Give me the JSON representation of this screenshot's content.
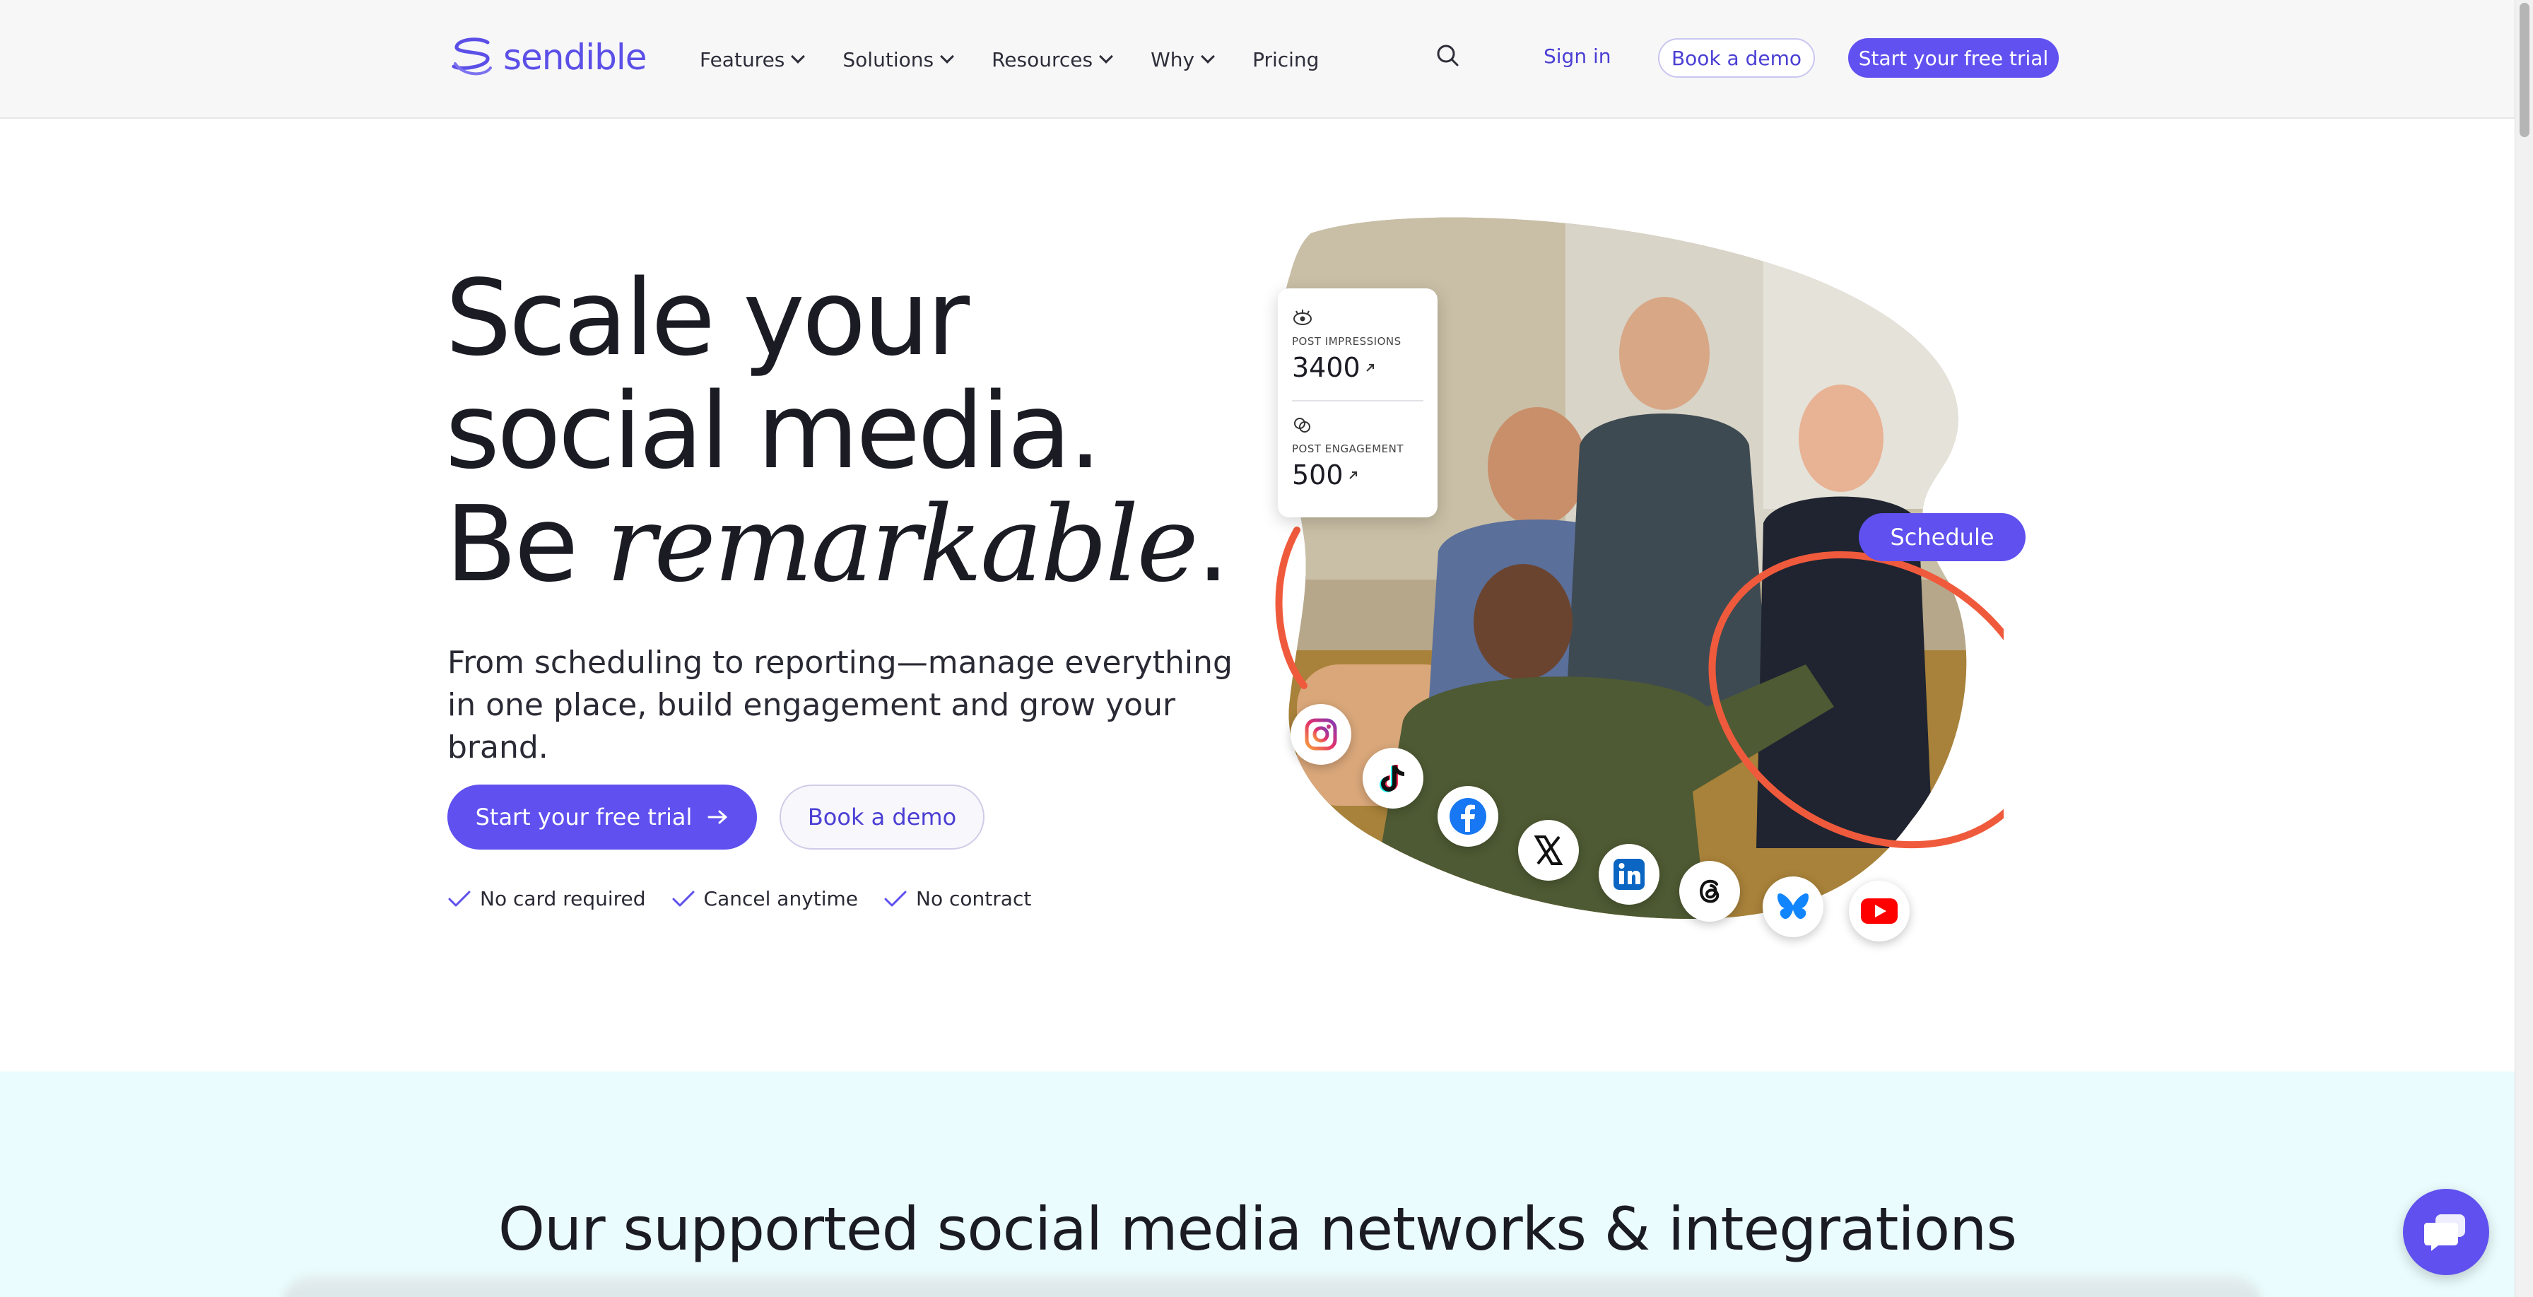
{
  "header": {
    "logo_text": "sendible",
    "nav": [
      {
        "label": "Features",
        "dropdown": true
      },
      {
        "label": "Solutions",
        "dropdown": true
      },
      {
        "label": "Resources",
        "dropdown": true
      },
      {
        "label": "Why",
        "dropdown": true
      },
      {
        "label": "Pricing",
        "dropdown": false
      }
    ],
    "search_icon": "search-icon",
    "signin_label": "Sign in",
    "book_demo_label": "Book a demo",
    "trial_label": "Start your free trial"
  },
  "hero": {
    "line1": "Scale your",
    "line2": "social media.",
    "line3_prefix": "Be ",
    "line3_italic": "remarkable",
    "line3_suffix": ".",
    "subtitle": "From scheduling to reporting—manage everything in one place, build engagement and grow your brand.",
    "cta_primary": "Start your free trial",
    "cta_secondary": "Book a demo",
    "checks": [
      "No card required",
      "Cancel anytime",
      "No contract"
    ]
  },
  "stats_card": {
    "impressions_label": "POST IMPRESSIONS",
    "impressions_value": "3400",
    "engagement_label": "POST ENGAGEMENT",
    "engagement_value": "500"
  },
  "schedule_label": "Schedule",
  "social_icons": [
    "instagram-icon",
    "tiktok-icon",
    "facebook-icon",
    "x-icon",
    "linkedin-icon",
    "threads-icon",
    "bluesky-icon",
    "youtube-icon"
  ],
  "networks": {
    "title": "Our supported social media networks & integrations"
  },
  "colors": {
    "brand": "#5f50ef",
    "accent_red": "#f05a3c",
    "networks_bg": "#eafcfd"
  }
}
